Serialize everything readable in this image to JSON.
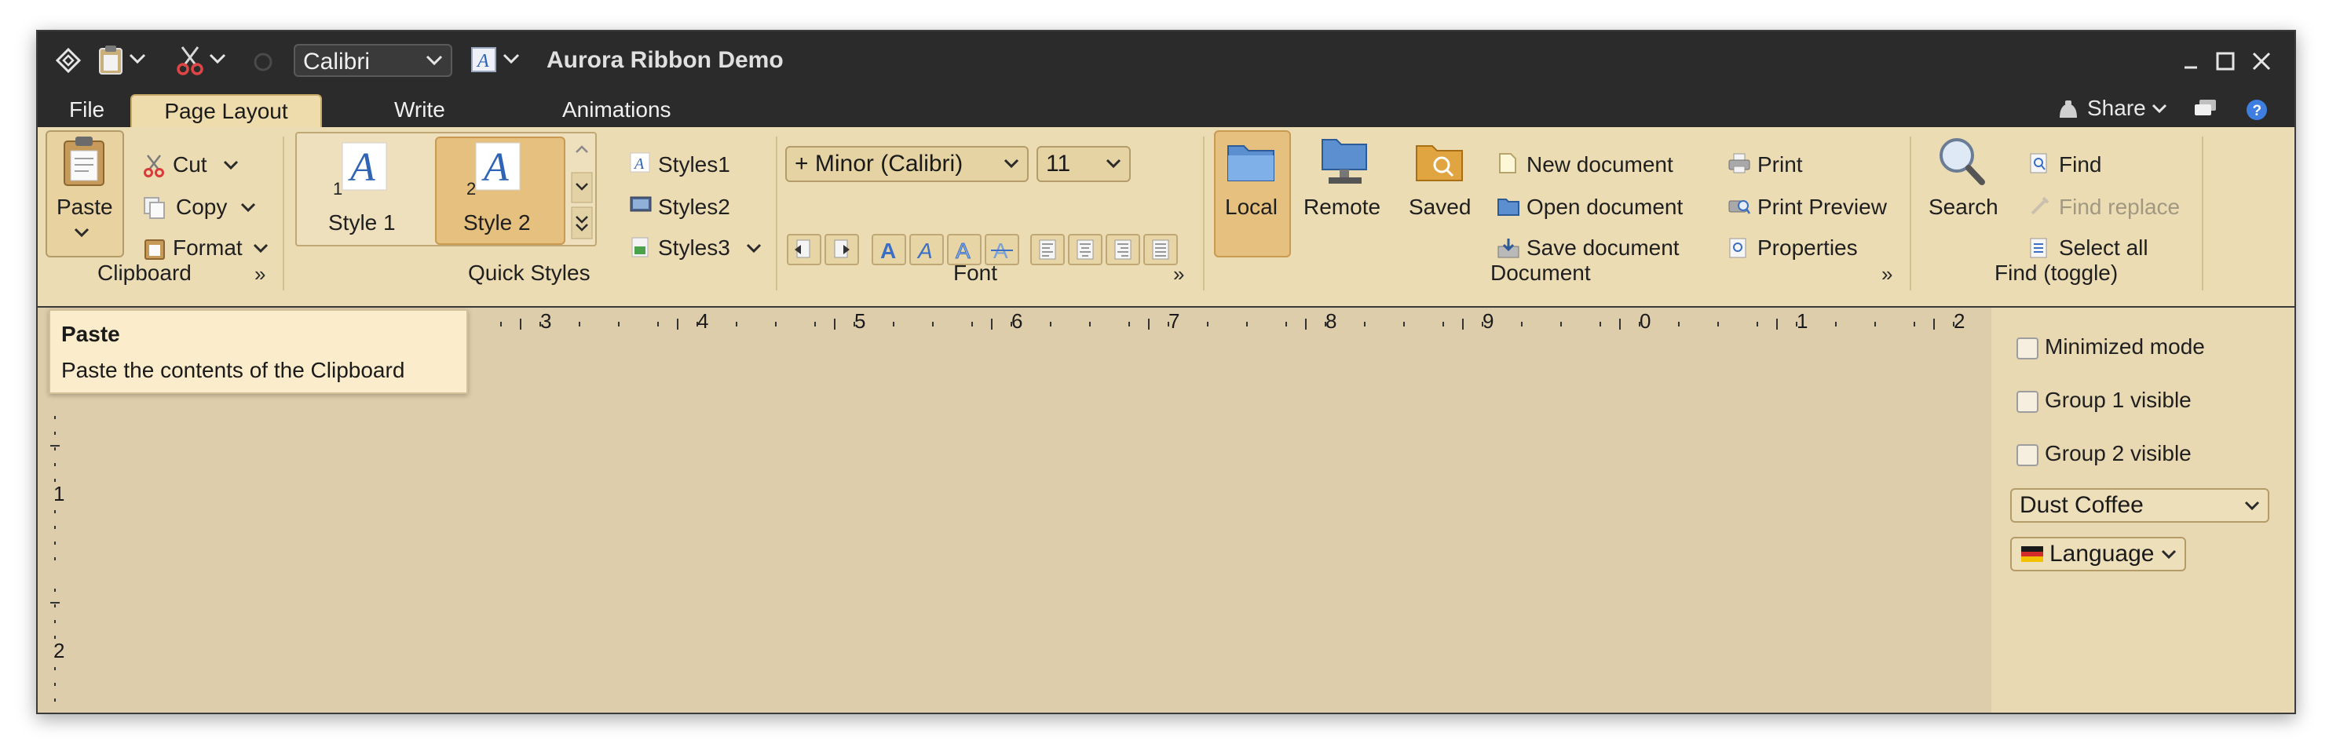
{
  "window": {
    "title": "Aurora Ribbon Demo"
  },
  "quick_access": {
    "font_name": "Calibri"
  },
  "tabs": [
    {
      "label": "File",
      "active": false
    },
    {
      "label": "Page Layout",
      "active": true
    },
    {
      "label": "Write",
      "active": false
    },
    {
      "label": "Animations",
      "active": false
    }
  ],
  "top_right": {
    "share_label": "Share"
  },
  "clipboard": {
    "paste_label": "Paste",
    "cut_label": "Cut",
    "copy_label": "Copy",
    "format_label": "Format",
    "group_label": "Clipboard"
  },
  "quick_styles": {
    "style1_label": "Style 1",
    "style2_label": "Style 2",
    "style1_num": "1",
    "style2_num": "2",
    "styles1_label": "Styles1",
    "styles2_label": "Styles2",
    "styles3_label": "Styles3",
    "group_label": "Quick Styles"
  },
  "font": {
    "family_value": "+ Minor (Calibri)",
    "size_value": "11",
    "group_label": "Font"
  },
  "document": {
    "local_label": "Local",
    "remote_label": "Remote",
    "saved_label": "Saved",
    "new_label": "New document",
    "open_label": "Open document",
    "save_label": "Save document",
    "print_label": "Print",
    "print_preview_label": "Print Preview",
    "properties_label": "Properties",
    "group_label": "Document"
  },
  "find": {
    "search_label": "Search",
    "find_label": "Find",
    "find_replace_label": "Find replace",
    "select_all_label": "Select all",
    "group_label": "Find (toggle)"
  },
  "tooltip": {
    "title": "Paste",
    "text": "Paste the contents of the Clipboard"
  },
  "ruler": {
    "h_labels": [
      "3",
      "4",
      "5",
      "6",
      "7",
      "8",
      "9",
      "0",
      "1",
      "2"
    ],
    "v_labels": [
      "1",
      "2"
    ]
  },
  "side_panel": {
    "minimized_label": "Minimized mode",
    "group1_label": "Group 1 visible",
    "group2_label": "Group 2 visible",
    "skin_value": "Dust Coffee",
    "language_label": "Language"
  },
  "colors": {
    "titlebar": "#2b2b2b",
    "ribbon": "#ecdcb4",
    "content": "#decdab",
    "highlight": "#e6c07e",
    "accent_blue": "#3a6fc4"
  }
}
